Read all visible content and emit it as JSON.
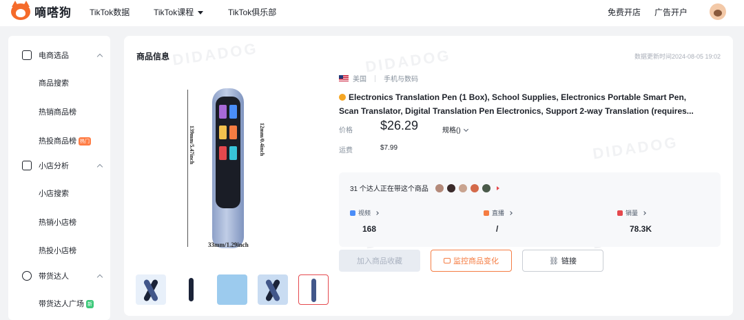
{
  "topbar": {
    "logo_text": "嘀嗒狗",
    "nav": [
      "TikTok数据",
      "TikTok课程",
      "TikTok俱乐部"
    ],
    "right_links": [
      "免费开店",
      "广告开户"
    ]
  },
  "sidebar": {
    "groups": [
      {
        "label": "电商选品",
        "icon": "bag-icon",
        "items": [
          {
            "label": "商品搜索"
          },
          {
            "label": "热销商品榜"
          },
          {
            "label": "热投商品榜",
            "badge": "热门"
          }
        ]
      },
      {
        "label": "小店分析",
        "icon": "store-icon",
        "items": [
          {
            "label": "小店搜索"
          },
          {
            "label": "热销小店榜"
          },
          {
            "label": "热投小店榜"
          }
        ]
      },
      {
        "label": "带货达人",
        "icon": "person-icon",
        "items": [
          {
            "label": "带货达人广场",
            "badge": "新"
          }
        ]
      }
    ]
  },
  "panel": {
    "title": "商品信息",
    "update_time": "数据更新时间2024-08-05 19:02",
    "watermark": "DIDADOG"
  },
  "product": {
    "image_labels": {
      "height": "139mm/5.47inch",
      "thickness": "12mm/0.4inch",
      "width": "33mm/1.29inch"
    },
    "country": "美国",
    "category": "手机与数码",
    "title": "Electronics Translation Pen (1 Box), School Supplies, Electronics Portable Smart Pen, Scan Translator, Digital Translation Pen Electronics, Support 2-way Translation (requires...",
    "price_label": "价格",
    "price": "$26.29",
    "spec_label": "规格()",
    "shipping_label": "运费",
    "shipping": "$7.99"
  },
  "stats": {
    "creators_text": "31 个达人正在带这个商品",
    "items": [
      {
        "label": "视频",
        "value": "168",
        "color": "#4a8df8"
      },
      {
        "label": "直播",
        "value": "/",
        "color": "#f57c42"
      },
      {
        "label": "销量",
        "value": "78.3K",
        "color": "#e5484d"
      }
    ]
  },
  "buttons": {
    "favorite": "加入商品收藏",
    "monitor": "监控商品变化",
    "link": "链接"
  },
  "colors": {
    "brand": "#f56b2a",
    "accent": "#f57c42",
    "active_thumb": "#e5484d"
  }
}
